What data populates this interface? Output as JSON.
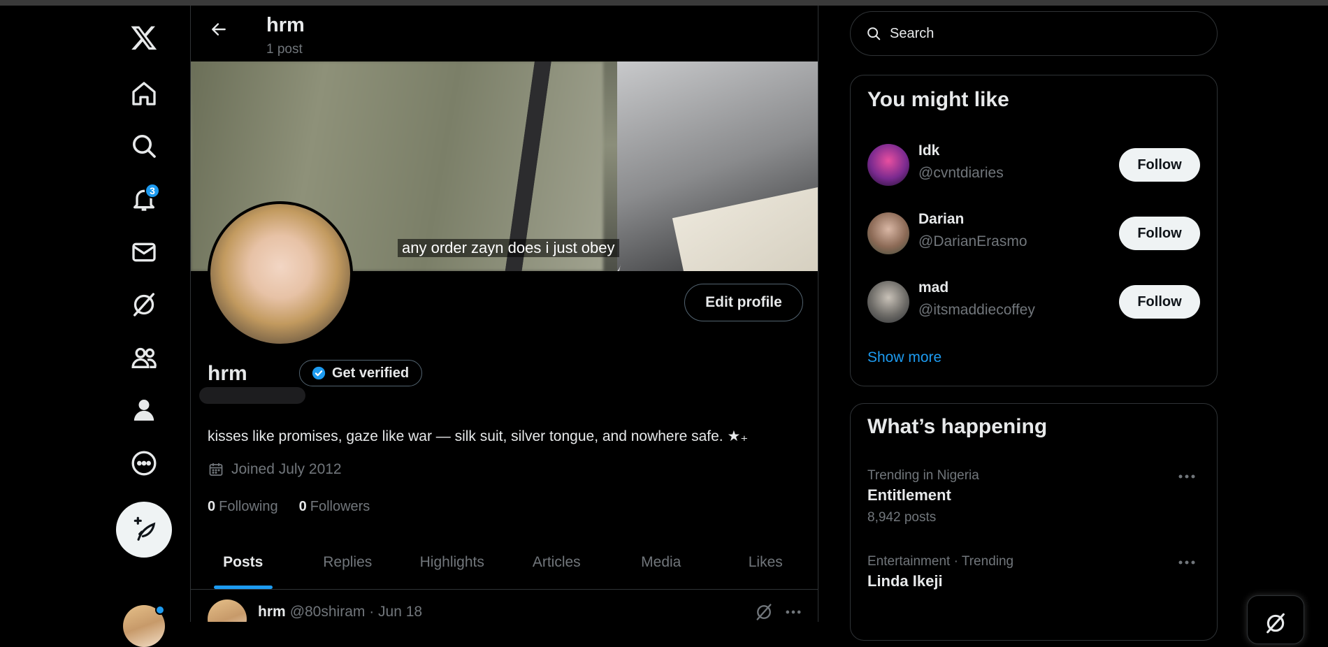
{
  "header": {
    "title": "hrm",
    "post_count": "1 post"
  },
  "nav": {
    "notifications_badge": "3"
  },
  "banner": {
    "caption": "any order zayn does i just obey"
  },
  "profile": {
    "edit_label": "Edit profile",
    "name": "hrm",
    "verify_label": "Get verified",
    "bio": "kisses like promises, gaze like war — silk suit, silver tongue, and nowhere safe. ★₊",
    "joined": "Joined July 2012",
    "following_count": "0",
    "following_label": "Following",
    "followers_count": "0",
    "followers_label": "Followers"
  },
  "tabs": [
    "Posts",
    "Replies",
    "Highlights",
    "Articles",
    "Media",
    "Likes"
  ],
  "post": {
    "name": "hrm",
    "handle_date": "@80shiram · Jun 18"
  },
  "search": {
    "placeholder": "Search"
  },
  "suggestions": {
    "title": "You might like",
    "items": [
      {
        "name": "Idk",
        "handle": "@cvntdiaries",
        "follow": "Follow"
      },
      {
        "name": "Darian",
        "handle": "@DarianErasmo",
        "follow": "Follow"
      },
      {
        "name": "mad",
        "handle": "@itsmaddiecoffey",
        "follow": "Follow"
      }
    ],
    "show_more": "Show more"
  },
  "happening": {
    "title": "What’s happening",
    "trends": [
      {
        "context": "Trending in Nigeria",
        "name": "Entitlement",
        "count": "8,942 posts"
      },
      {
        "context": "Entertainment · Trending",
        "name": "Linda Ikeji",
        "count": ""
      }
    ]
  },
  "colors": {
    "accent": "#1d9bf0",
    "background": "#000000",
    "muted": "#71767b"
  }
}
